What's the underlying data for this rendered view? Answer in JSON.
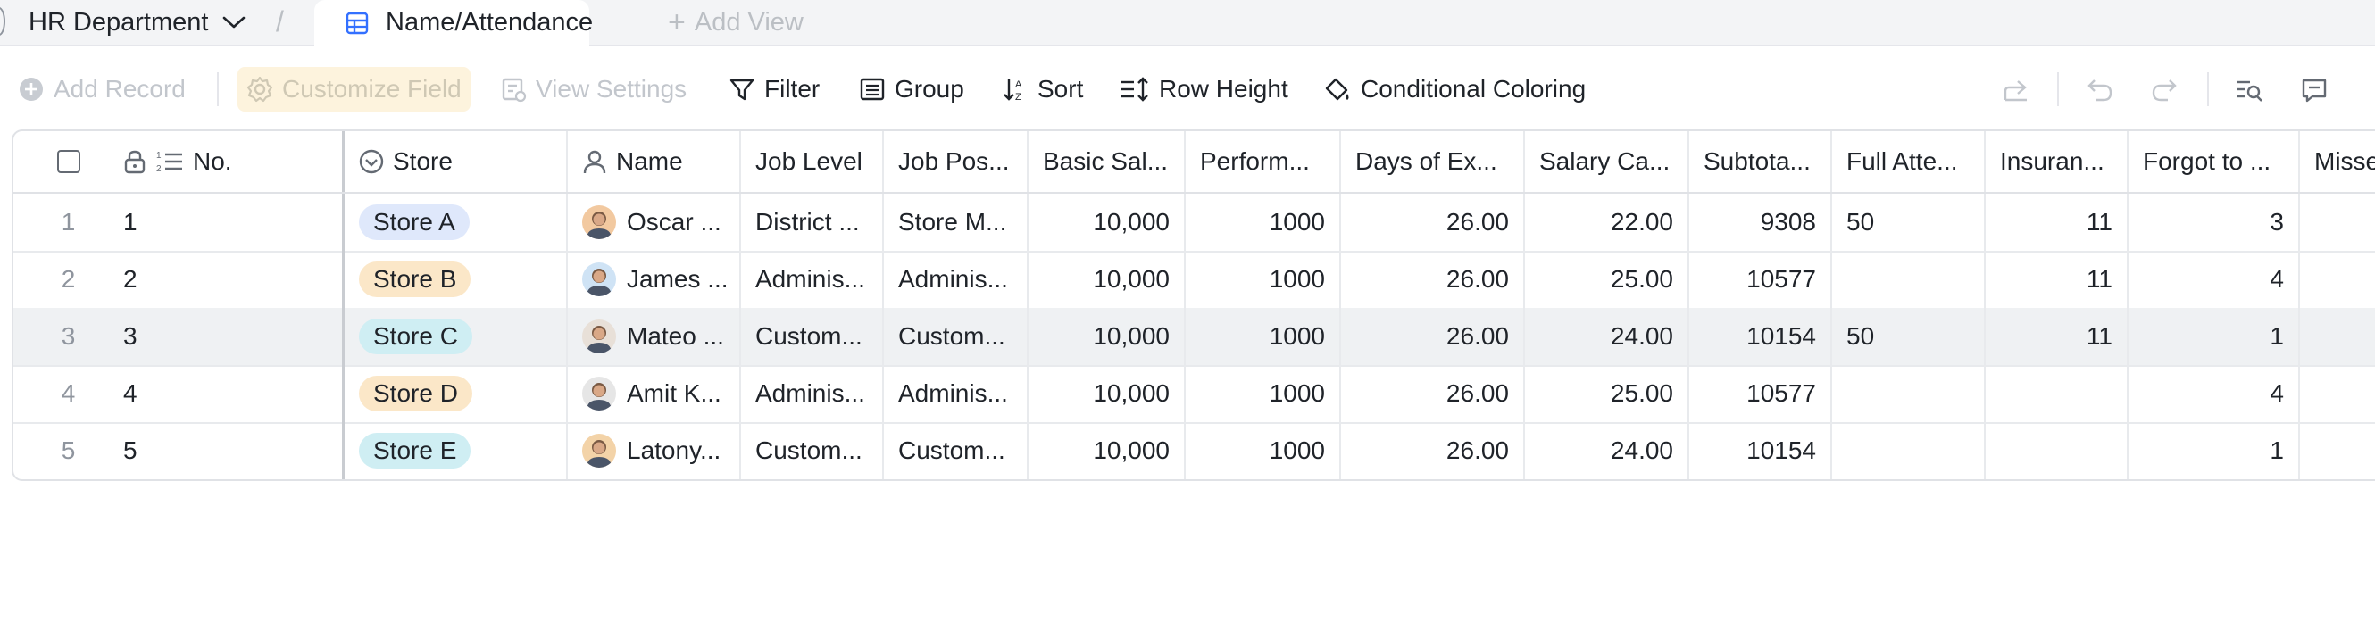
{
  "tabbar": {
    "table_name": "HR Department",
    "active_view": "Name/Attendance",
    "add_view": "Add View"
  },
  "toolbar": {
    "add_record": "Add Record",
    "customize_field": "Customize Field",
    "view_settings": "View Settings",
    "filter": "Filter",
    "group": "Group",
    "sort": "Sort",
    "row_height": "Row Height",
    "conditional_coloring": "Conditional Coloring"
  },
  "columns": [
    "No.",
    "Store",
    "Name",
    "Job Level",
    "Job Pos...",
    "Basic Sal...",
    "Perform...",
    "Days of Ex...",
    "Salary Ca...",
    "Subtota...",
    "Full Atte...",
    "Insuran...",
    "Forgot to ...",
    "Misse"
  ],
  "rows": [
    {
      "idx": "1",
      "no": "1",
      "store": "Store A",
      "store_color": "#dfe8fb",
      "name": "Oscar ...",
      "avatar_bg": "#f2c9a0",
      "job_level": "District ...",
      "job_pos": "Store M...",
      "basic": "10,000",
      "perform": "1000",
      "days": "26.00",
      "salary_ca": "22.00",
      "subtotal": "9308",
      "full_att": "50",
      "insurance": "11",
      "forgot": "3",
      "missed": ""
    },
    {
      "idx": "2",
      "no": "2",
      "store": "Store B",
      "store_color": "#fbe7c8",
      "name": "James ...",
      "avatar_bg": "#cfe3f5",
      "job_level": "Adminis...",
      "job_pos": "Adminis...",
      "basic": "10,000",
      "perform": "1000",
      "days": "26.00",
      "salary_ca": "25.00",
      "subtotal": "10577",
      "full_att": "",
      "insurance": "11",
      "forgot": "4",
      "missed": ""
    },
    {
      "idx": "3",
      "no": "3",
      "store": "Store C",
      "store_color": "#cfeef3",
      "name": "Mateo ...",
      "avatar_bg": "#e8e0d8",
      "job_level": "Custom...",
      "job_pos": "Custom...",
      "basic": "10,000",
      "perform": "1000",
      "days": "26.00",
      "salary_ca": "24.00",
      "subtotal": "10154",
      "full_att": "50",
      "insurance": "11",
      "forgot": "1",
      "missed": ""
    },
    {
      "idx": "4",
      "no": "4",
      "store": "Store D",
      "store_color": "#fbe7c8",
      "name": "Amit K...",
      "avatar_bg": "#e6e6e6",
      "job_level": "Adminis...",
      "job_pos": "Adminis...",
      "basic": "10,000",
      "perform": "1000",
      "days": "26.00",
      "salary_ca": "25.00",
      "subtotal": "10577",
      "full_att": "",
      "insurance": "",
      "forgot": "4",
      "missed": ""
    },
    {
      "idx": "5",
      "no": "5",
      "store": "Store E",
      "store_color": "#cfeef3",
      "name": "Latony...",
      "avatar_bg": "#f3d3a8",
      "job_level": "Custom...",
      "job_pos": "Custom...",
      "basic": "10,000",
      "perform": "1000",
      "days": "26.00",
      "salary_ca": "24.00",
      "subtotal": "10154",
      "full_att": "",
      "insurance": "",
      "forgot": "1",
      "missed": ""
    }
  ],
  "icons": {
    "dropdown": "chevron-down-icon",
    "table_view": "grid-table-icon",
    "add": "plus-icon",
    "lock": "lock-icon",
    "autonumber": "ordered-list-icon",
    "single_select": "circle-chevron-icon",
    "person": "person-icon"
  }
}
